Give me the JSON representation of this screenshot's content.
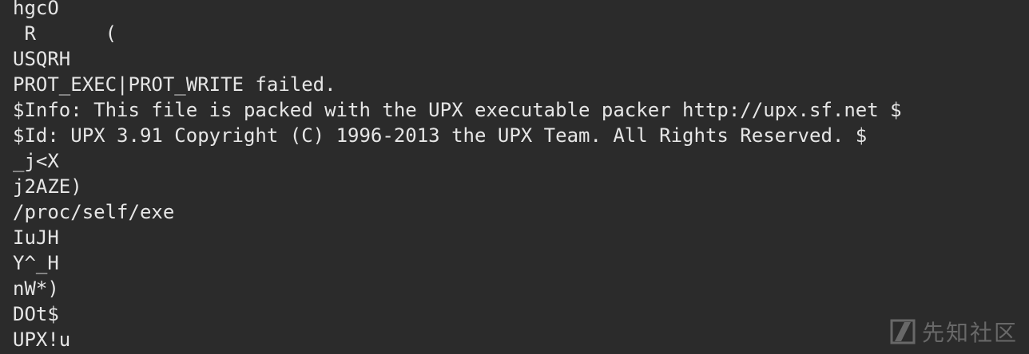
{
  "terminal": {
    "lines": [
      "hgcO",
      " R      (",
      "USQRH",
      "PROT_EXEC|PROT_WRITE failed.",
      "$Info: This file is packed with the UPX executable packer http://upx.sf.net $",
      "$Id: UPX 3.91 Copyright (C) 1996-2013 the UPX Team. All Rights Reserved. $",
      "_j<X",
      "j2AZE)",
      "/proc/self/exe",
      "IuJH",
      "Y^_H",
      "nW*)",
      "DOt$",
      "UPX!u"
    ]
  },
  "watermark": {
    "text": "先知社区",
    "icon": "xianzhi-logo-icon"
  },
  "colors": {
    "background": "#2b2b2b",
    "text": "#e6e6e6",
    "watermark": "#9a9a9a"
  }
}
